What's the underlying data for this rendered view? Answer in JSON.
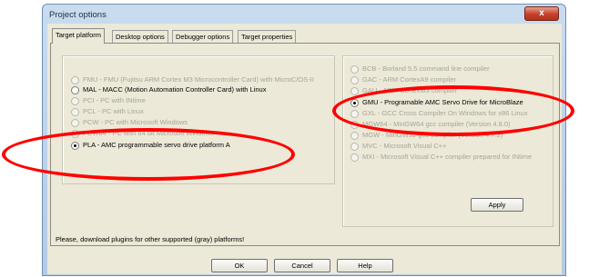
{
  "window": {
    "title": "Project options",
    "close_glyph": "x"
  },
  "tabs": [
    {
      "label": "Target platform",
      "active": true
    },
    {
      "label": "Desktop options",
      "active": false
    },
    {
      "label": "Debugger options",
      "active": false
    },
    {
      "label": "Target properties",
      "active": false
    }
  ],
  "left_options": [
    {
      "label": "FMU - FMU (Fujitsu ARM Cortex M3 Microcontroller Card) with MicroC/OS-II",
      "enabled": false,
      "selected": false
    },
    {
      "label": "MAL - MACC (Motion Automation Controller Card) with Linux",
      "enabled": true,
      "selected": false
    },
    {
      "label": "PCI - PC with INtime",
      "enabled": false,
      "selected": false
    },
    {
      "label": "PCL - PC with Linux",
      "enabled": false,
      "selected": false
    },
    {
      "label": "PCW - PC with Microsoft Windows",
      "enabled": false,
      "selected": false
    },
    {
      "label": "PCW64 - PC with 64 bit Microsoft Windows",
      "enabled": false,
      "selected": false
    },
    {
      "label": "PLA - AMC programmable servo drive platform A",
      "enabled": true,
      "selected": true
    }
  ],
  "right_options": [
    {
      "label": "BCB - Borland 5.5 command line compiler",
      "enabled": false,
      "selected": false
    },
    {
      "label": "GAC - ARM CortexA9 compiler",
      "enabled": false,
      "selected": false
    },
    {
      "label": "GAU - ARM CortexM3 compiler",
      "enabled": false,
      "selected": false
    },
    {
      "label": "GMU - Programable AMC Servo Drive for MicroBlaze",
      "enabled": true,
      "selected": true
    },
    {
      "label": "GXL - GCC Cross Compiler On Windows for x86 Linux",
      "enabled": false,
      "selected": false
    },
    {
      "label": "MGW64 - MinGW64 gcc compiler (Version 4.8.0)",
      "enabled": false,
      "selected": false
    },
    {
      "label": "MGW - MinGW32 gcc compiler (Version 4.7.2)",
      "enabled": false,
      "selected": false
    },
    {
      "label": "MVC - Microsoft Visual C++",
      "enabled": false,
      "selected": false
    },
    {
      "label": "MXI - Microsoft Visual C++ compiler prepared for INtime",
      "enabled": false,
      "selected": false
    }
  ],
  "apply_label": "Apply",
  "footer_message": "Please, download plugins for other supported (gray) platforms!",
  "buttons": {
    "ok": "OK",
    "cancel": "Cancel",
    "help": "Help"
  },
  "colors": {
    "annotation_red": "#ff0000",
    "disabled_text": "#a6a49a"
  }
}
